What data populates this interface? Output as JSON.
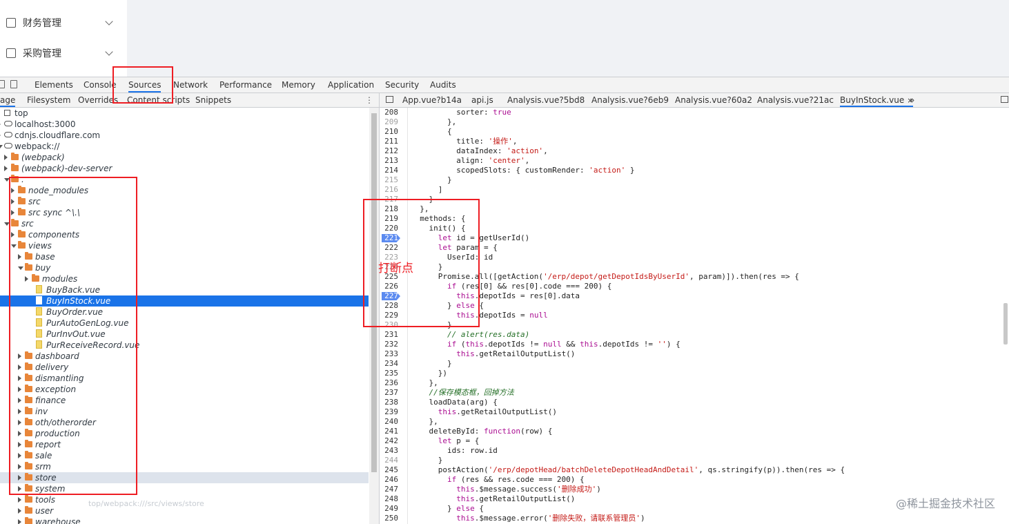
{
  "app_menu": [
    {
      "label": "财务管理",
      "icon": "finance-icon"
    },
    {
      "label": "采购管理",
      "icon": "purchase-icon"
    }
  ],
  "devtools": {
    "tabs": [
      "Elements",
      "Console",
      "Sources",
      "Network",
      "Performance",
      "Memory",
      "Application",
      "Security",
      "Audits"
    ],
    "active_tab": "Sources",
    "navigator_tabs": [
      "age",
      "Filesystem",
      "Overrides",
      "Content scripts",
      "Snippets"
    ],
    "file_tabs": [
      "App.vue?b14a",
      "api.js",
      "Analysis.vue?5bd8",
      "Analysis.vue?6eb9",
      "Analysis.vue?60a2",
      "Analysis.vue?21ac",
      "BuyInStock.vue"
    ],
    "file_tabs_more": "»",
    "close_label": "×",
    "tree": [
      {
        "label": "top",
        "kind": "frame"
      },
      {
        "label": "localhost:3000",
        "kind": "cloud"
      },
      {
        "label": "cdnjs.cloudflare.com",
        "kind": "cloud"
      },
      {
        "label": "webpack://",
        "kind": "cloud"
      },
      {
        "label": "(webpack)",
        "kind": "folder"
      },
      {
        "label": "(webpack)-dev-server",
        "kind": "folder"
      },
      {
        "label": ".",
        "kind": "folder"
      },
      {
        "label": "node_modules",
        "kind": "folder"
      },
      {
        "label": "src",
        "kind": "folder"
      },
      {
        "label": "src sync ^\\.\\",
        "kind": "folder"
      },
      {
        "label": "src",
        "kind": "folder"
      },
      {
        "label": "components",
        "kind": "folder"
      },
      {
        "label": "views",
        "kind": "folder"
      },
      {
        "label": "base",
        "kind": "folder"
      },
      {
        "label": "buy",
        "kind": "folder"
      },
      {
        "label": "modules",
        "kind": "folder"
      },
      {
        "label": "BuyBack.vue",
        "kind": "file"
      },
      {
        "label": "BuyInStock.vue",
        "kind": "file"
      },
      {
        "label": "BuyOrder.vue",
        "kind": "file"
      },
      {
        "label": "PurAutoGenLog.vue",
        "kind": "file"
      },
      {
        "label": "PurInvOut.vue",
        "kind": "file"
      },
      {
        "label": "PurReceiveRecord.vue",
        "kind": "file"
      },
      {
        "label": "dashboard",
        "kind": "folder"
      },
      {
        "label": "delivery",
        "kind": "folder"
      },
      {
        "label": "dismantling",
        "kind": "folder"
      },
      {
        "label": "exception",
        "kind": "folder"
      },
      {
        "label": "finance",
        "kind": "folder"
      },
      {
        "label": "inv",
        "kind": "folder"
      },
      {
        "label": "oth/otherorder",
        "kind": "folder"
      },
      {
        "label": "production",
        "kind": "folder"
      },
      {
        "label": "report",
        "kind": "folder"
      },
      {
        "label": "sale",
        "kind": "folder"
      },
      {
        "label": "srm",
        "kind": "folder"
      },
      {
        "label": "store",
        "kind": "folder"
      },
      {
        "label": "system",
        "kind": "folder"
      },
      {
        "label": "tools",
        "kind": "folder"
      },
      {
        "label": "user",
        "kind": "folder"
      },
      {
        "label": "warehouse",
        "kind": "folder"
      }
    ],
    "selected_file": "BuyInStock.vue",
    "hover_tooltip": "top/webpack:///src/views/store",
    "breakpoints": [
      221,
      227
    ],
    "code_lines": [
      {
        "n": "208",
        "t": "          sorter: true"
      },
      {
        "n": "209",
        "t": "        },"
      },
      {
        "n": "210",
        "t": "        {"
      },
      {
        "n": "211",
        "t": "          title: '操作',"
      },
      {
        "n": "212",
        "t": "          dataIndex: 'action',"
      },
      {
        "n": "213",
        "t": "          align: 'center',"
      },
      {
        "n": "214",
        "t": "          scopedSlots: { customRender: 'action' }"
      },
      {
        "n": "215",
        "t": "        }"
      },
      {
        "n": "216",
        "t": "      ]"
      },
      {
        "n": "217",
        "t": "    }"
      },
      {
        "n": "218",
        "t": "  },"
      },
      {
        "n": "219",
        "t": "  methods: {"
      },
      {
        "n": "220",
        "t": "    init() {"
      },
      {
        "n": "221",
        "t": "      let id = getUserId()"
      },
      {
        "n": "222",
        "t": "      let param = {"
      },
      {
        "n": "223",
        "t": "        UserId: id"
      },
      {
        "n": "224",
        "t": "      }"
      },
      {
        "n": "225",
        "t": "      Promise.all([getAction('/erp/depot/getDepotIdsByUserId', param)]).then(res => {"
      },
      {
        "n": "226",
        "t": "        if (res[0] && res[0].code === 200) {"
      },
      {
        "n": "227",
        "t": "          this.depotIds = res[0].data"
      },
      {
        "n": "228",
        "t": "        } else {"
      },
      {
        "n": "229",
        "t": "          this.depotIds = null"
      },
      {
        "n": "230",
        "t": "        }"
      },
      {
        "n": "231",
        "t": "        // alert(res.data)"
      },
      {
        "n": "232",
        "t": "        if (this.depotIds != null && this.depotIds != '') {"
      },
      {
        "n": "233",
        "t": "          this.getRetailOutputList()"
      },
      {
        "n": "234",
        "t": "        }"
      },
      {
        "n": "235",
        "t": "      })"
      },
      {
        "n": "236",
        "t": "    },"
      },
      {
        "n": "237",
        "t": "    //保存模态框，回掉方法"
      },
      {
        "n": "238",
        "t": "    loadData(arg) {"
      },
      {
        "n": "239",
        "t": "      this.getRetailOutputList()"
      },
      {
        "n": "240",
        "t": "    },"
      },
      {
        "n": "241",
        "t": "    deleteById: function(row) {"
      },
      {
        "n": "242",
        "t": "      let p = {"
      },
      {
        "n": "243",
        "t": "        ids: row.id"
      },
      {
        "n": "244",
        "t": "      }"
      },
      {
        "n": "245",
        "t": "      postAction('/erp/depotHead/batchDeleteDepotHeadAndDetail', qs.stringify(p)).then(res => {"
      },
      {
        "n": "246",
        "t": "        if (res && res.code === 200) {"
      },
      {
        "n": "247",
        "t": "          this.$message.success('删除成功')"
      },
      {
        "n": "248",
        "t": "          this.getRetailOutputList()"
      },
      {
        "n": "249",
        "t": "        } else {"
      },
      {
        "n": "250",
        "t": "          this.$message.error('删除失败，请联系管理员')"
      }
    ]
  },
  "annotation_label": "打断点",
  "watermark": "@稀土掘金技术社区",
  "colors": {
    "accent": "#1a73e8",
    "annotation": "#ee1d23",
    "folder": "#e8863a",
    "breakpoint": "#5c8bf0"
  }
}
